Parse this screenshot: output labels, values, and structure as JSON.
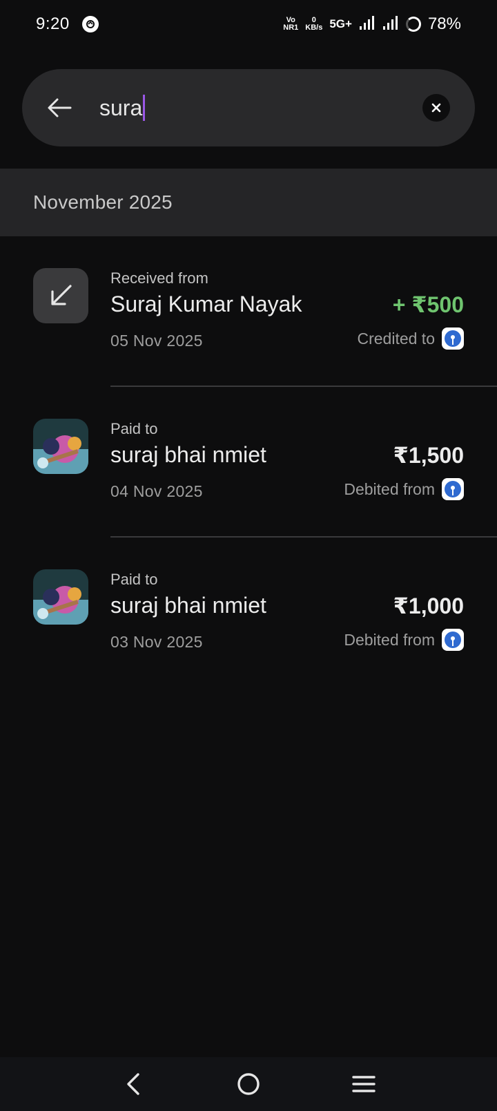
{
  "status_bar": {
    "time": "9:20",
    "volte_top": "Vo",
    "volte_bottom": "NR1",
    "speed_value": "0",
    "speed_unit": "KB/s",
    "network": "5G+",
    "battery": "78%"
  },
  "search": {
    "query": "sura",
    "back_icon": "arrow-left-icon",
    "clear_icon": "close-icon"
  },
  "month": "November 2025",
  "transactions": [
    {
      "type_label": "Received from",
      "name": "Suraj Kumar Nayak",
      "amount": "+ ₹500",
      "date": "05 Nov 2025",
      "account_label": "Credited to",
      "direction": "credit",
      "amount_color": "#6fc46f"
    },
    {
      "type_label": "Paid to",
      "name": "suraj bhai nmiet",
      "amount": "₹1,500",
      "date": "04 Nov 2025",
      "account_label": "Debited from",
      "direction": "debit"
    },
    {
      "type_label": "Paid to",
      "name": "suraj bhai nmiet",
      "amount": "₹1,000",
      "date": "03 Nov 2025",
      "account_label": "Debited from",
      "direction": "debit"
    }
  ],
  "nav": {
    "back_icon": "chevron-left-icon",
    "home_icon": "circle-home-icon",
    "recents_icon": "menu-icon"
  },
  "colors": {
    "background": "#0d0d0e",
    "search_bg": "#29292b",
    "caret": "#9a57e6",
    "credit": "#6fc46f",
    "bank_blue": "#2f6ad0"
  }
}
